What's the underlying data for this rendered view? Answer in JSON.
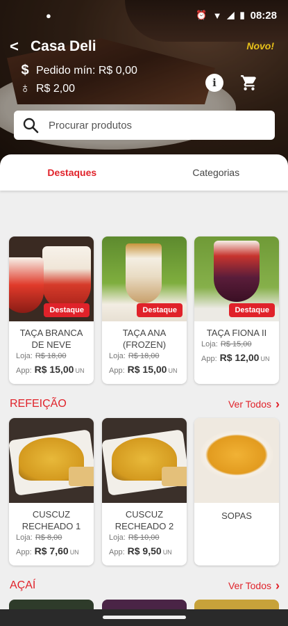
{
  "status_bar": {
    "time": "08:28"
  },
  "header": {
    "title": "Casa Deli",
    "badge": "Novo!",
    "min_order": "Pedido mín: R$ 0,00",
    "delivery_fee": "R$ 2,00"
  },
  "search": {
    "placeholder": "Procurar produtos"
  },
  "tabs": [
    {
      "label": "Destaques",
      "active": true
    },
    {
      "label": "Categorias",
      "active": false
    }
  ],
  "featured": [
    {
      "badge": "Destaque",
      "name": "TAÇA BRANCA DE NEVE",
      "loja_label": "Loja:",
      "loja_price": "R$ 18,00",
      "app_label": "App:",
      "app_price": "R$ 15,00",
      "unit": "UN"
    },
    {
      "badge": "Destaque",
      "name": "TAÇA ANA (FROZEN)",
      "loja_label": "Loja:",
      "loja_price": "R$ 18,00",
      "app_label": "App:",
      "app_price": "R$ 15,00",
      "unit": "UN"
    },
    {
      "badge": "Destaque",
      "name": "TAÇA FIONA II",
      "loja_label": "Loja:",
      "loja_price": "R$ 15,00",
      "app_label": "App:",
      "app_price": "R$ 12,00",
      "unit": "UN"
    }
  ],
  "sections": [
    {
      "title": "REFEIÇÃO",
      "link": "Ver Todos",
      "items": [
        {
          "name": "CUSCUZ RECHEADO 1",
          "loja_label": "Loja:",
          "loja_price": "R$ 8,00",
          "app_label": "App:",
          "app_price": "R$ 7,60",
          "unit": "UN"
        },
        {
          "name": "CUSCUZ RECHEADO 2",
          "loja_label": "Loja:",
          "loja_price": "R$ 10,00",
          "app_label": "App:",
          "app_price": "R$ 9,50",
          "unit": "UN"
        },
        {
          "name": "SOPAS"
        }
      ]
    },
    {
      "title": "AÇAÍ",
      "link": "Ver Todos"
    }
  ],
  "colors": {
    "accent": "#e0222a",
    "novo": "#e9c21a"
  }
}
